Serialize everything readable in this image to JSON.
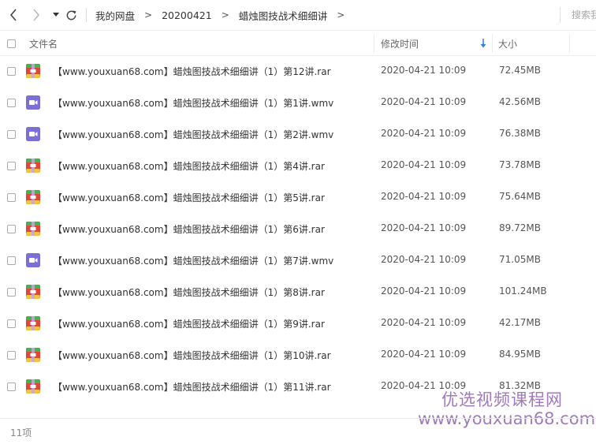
{
  "nav": {
    "back_icon": "chevron-left-icon",
    "forward_icon": "chevron-right-icon",
    "dropdown_icon": "caret-down-icon",
    "refresh_icon": "refresh-icon"
  },
  "breadcrumb": {
    "items": [
      "我的网盘",
      "20200421",
      "蜡烛图技战术细细讲"
    ],
    "separator": ">"
  },
  "search": {
    "placeholder": "搜索我"
  },
  "columns": {
    "name": "文件名",
    "time": "修改时间",
    "size": "大小",
    "sort_icon": "sort-down-arrow-icon"
  },
  "files": [
    {
      "name": "【www.youxuan68.com】蜡烛图技战术细细讲（1）第12讲.rar",
      "time": "2020-04-21 10:09",
      "size": "72.45MB",
      "type": "rar"
    },
    {
      "name": "【www.youxuan68.com】蜡烛图技战术细细讲（1）第1讲.wmv",
      "time": "2020-04-21 10:09",
      "size": "42.56MB",
      "type": "video"
    },
    {
      "name": "【www.youxuan68.com】蜡烛图技战术细细讲（1）第2讲.wmv",
      "time": "2020-04-21 10:09",
      "size": "76.38MB",
      "type": "video"
    },
    {
      "name": "【www.youxuan68.com】蜡烛图技战术细细讲（1）第4讲.rar",
      "time": "2020-04-21 10:09",
      "size": "73.78MB",
      "type": "rar"
    },
    {
      "name": "【www.youxuan68.com】蜡烛图技战术细细讲（1）第5讲.rar",
      "time": "2020-04-21 10:09",
      "size": "75.64MB",
      "type": "rar"
    },
    {
      "name": "【www.youxuan68.com】蜡烛图技战术细细讲（1）第6讲.rar",
      "time": "2020-04-21 10:09",
      "size": "89.72MB",
      "type": "rar"
    },
    {
      "name": "【www.youxuan68.com】蜡烛图技战术细细讲（1）第7讲.wmv",
      "time": "2020-04-21 10:09",
      "size": "71.05MB",
      "type": "video"
    },
    {
      "name": "【www.youxuan68.com】蜡烛图技战术细细讲（1）第8讲.rar",
      "time": "2020-04-21 10:09",
      "size": "101.24MB",
      "type": "rar"
    },
    {
      "name": "【www.youxuan68.com】蜡烛图技战术细细讲（1）第9讲.rar",
      "time": "2020-04-21 10:09",
      "size": "42.17MB",
      "type": "rar"
    },
    {
      "name": "【www.youxuan68.com】蜡烛图技战术细细讲（1）第10讲.rar",
      "time": "2020-04-21 10:09",
      "size": "84.95MB",
      "type": "rar"
    },
    {
      "name": "【www.youxuan68.com】蜡烛图技战术细细讲（1）第11讲.rar",
      "time": "2020-04-21 10:09",
      "size": "81.32MB",
      "type": "rar"
    }
  ],
  "watermark": {
    "line1": "优选视频课程网",
    "line2": "www.youxuan68.com",
    "color": "#9b73b8"
  },
  "footer": {
    "count": "11项"
  },
  "colors": {
    "rar_icon_red": "#e0463c",
    "rar_icon_green": "#4caf50",
    "rar_icon_yellow": "#f5c342",
    "video_icon": "#7b6fd6",
    "sort_arrow": "#3b82d6"
  }
}
